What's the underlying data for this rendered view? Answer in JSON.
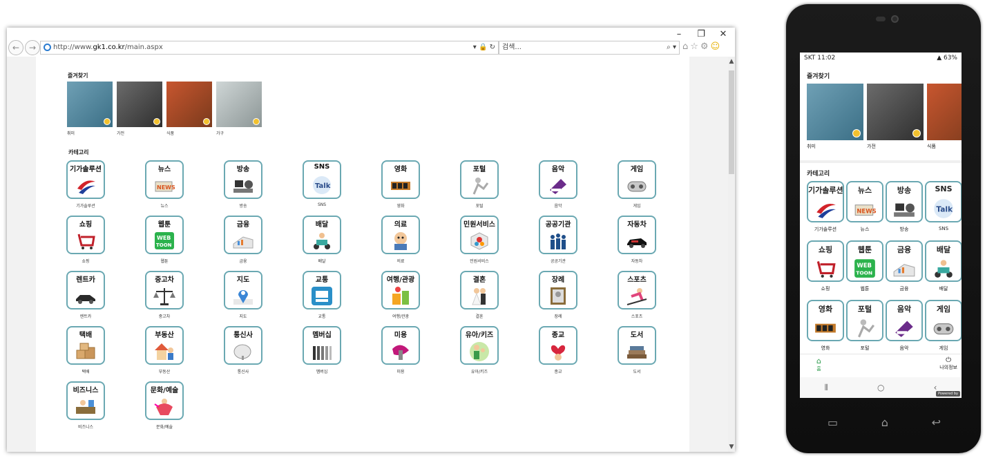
{
  "browser": {
    "url_prefix": "http://www.",
    "url_host": "gk1.co.kr",
    "url_path": "/main.aspx",
    "search_placeholder": "검색..."
  },
  "favorites": {
    "title": "즐겨찾기",
    "items": [
      {
        "label": "취미",
        "colors": [
          "#6fa0b5",
          "#3b6f86"
        ]
      },
      {
        "label": "가전",
        "colors": [
          "#6b6b6b",
          "#2f2f2f"
        ]
      },
      {
        "label": "식품",
        "colors": [
          "#c8562f",
          "#7a3a1c"
        ]
      },
      {
        "label": "가구",
        "colors": [
          "#cfd6d6",
          "#8c9696"
        ]
      }
    ]
  },
  "categories": {
    "title": "카테고리",
    "items": [
      {
        "title": "기가솔루션",
        "label": "기가솔루션",
        "icon": "giga-logo-icon"
      },
      {
        "title": "뉴스",
        "label": "뉴스",
        "icon": "news-icon"
      },
      {
        "title": "방송",
        "label": "방송",
        "icon": "broadcast-icon"
      },
      {
        "title": "SNS",
        "label": "SNS",
        "icon": "talk-icon"
      },
      {
        "title": "영화",
        "label": "영화",
        "icon": "film-icon"
      },
      {
        "title": "포털",
        "label": "포털",
        "icon": "portal-icon"
      },
      {
        "title": "음악",
        "label": "음악",
        "icon": "piano-icon"
      },
      {
        "title": "게임",
        "label": "게임",
        "icon": "gamepad-icon"
      },
      {
        "title": "쇼핑",
        "label": "쇼핑",
        "icon": "cart-icon"
      },
      {
        "title": "웹툰",
        "label": "웹툰",
        "icon": "webtoon-icon"
      },
      {
        "title": "금융",
        "label": "금융",
        "icon": "chart-icon"
      },
      {
        "title": "배달",
        "label": "배달",
        "icon": "scooter-icon"
      },
      {
        "title": "의료",
        "label": "의료",
        "icon": "doctor-icon"
      },
      {
        "title": "민원서비스",
        "label": "민원서비스",
        "icon": "cube-icon"
      },
      {
        "title": "공공기관",
        "label": "공공기관",
        "icon": "people-icon"
      },
      {
        "title": "자동차",
        "label": "자동차",
        "icon": "car-icon"
      },
      {
        "title": "렌트카",
        "label": "렌트카",
        "icon": "sedan-icon"
      },
      {
        "title": "중고차",
        "label": "중고차",
        "icon": "scale-icon"
      },
      {
        "title": "지도",
        "label": "지도",
        "icon": "map-pin-icon"
      },
      {
        "title": "교통",
        "label": "교통",
        "icon": "bus-icon"
      },
      {
        "title": "여행/관광",
        "label": "여행/관광",
        "icon": "luggage-icon"
      },
      {
        "title": "결혼",
        "label": "결혼",
        "icon": "wedding-icon"
      },
      {
        "title": "장례",
        "label": "장례",
        "icon": "frame-icon"
      },
      {
        "title": "스포츠",
        "label": "스포츠",
        "icon": "ski-icon"
      },
      {
        "title": "택배",
        "label": "택배",
        "icon": "boxes-icon"
      },
      {
        "title": "부동산",
        "label": "부동산",
        "icon": "realtor-icon"
      },
      {
        "title": "통신사",
        "label": "통신사",
        "icon": "dish-icon"
      },
      {
        "title": "멤버십",
        "label": "멤버십",
        "icon": "queue-icon"
      },
      {
        "title": "미용",
        "label": "미용",
        "icon": "lipstick-icon"
      },
      {
        "title": "유아/키즈",
        "label": "유아/키즈",
        "icon": "family-icon"
      },
      {
        "title": "종교",
        "label": "종교",
        "icon": "heart-icon"
      },
      {
        "title": "도서",
        "label": "도서",
        "icon": "books-icon"
      },
      {
        "title": "비즈니스",
        "label": "비즈니스",
        "icon": "business-icon"
      },
      {
        "title": "문화/예술",
        "label": "문화/예술",
        "icon": "dancer-icon"
      }
    ]
  },
  "phone": {
    "status_time": "SKT 11:02",
    "status_right": "63%",
    "favorites_title": "즐겨찾기",
    "favorites": [
      {
        "label": "취미",
        "colors": [
          "#6fa0b5",
          "#3b6f86"
        ]
      },
      {
        "label": "가전",
        "colors": [
          "#6b6b6b",
          "#2f2f2f"
        ]
      },
      {
        "label": "식품",
        "colors": [
          "#c8562f",
          "#7a3a1c"
        ]
      }
    ],
    "categories_title": "카테고리",
    "categories": [
      {
        "title": "기가솔루션",
        "label": "기가솔루션",
        "icon": "giga-logo-icon"
      },
      {
        "title": "뉴스",
        "label": "뉴스",
        "icon": "news-icon"
      },
      {
        "title": "방송",
        "label": "방송",
        "icon": "broadcast-icon"
      },
      {
        "title": "SNS",
        "label": "SNS",
        "icon": "talk-icon"
      },
      {
        "title": "쇼핑",
        "label": "쇼핑",
        "icon": "cart-icon"
      },
      {
        "title": "웹툰",
        "label": "웹툰",
        "icon": "webtoon-icon"
      },
      {
        "title": "금융",
        "label": "금융",
        "icon": "chart-icon"
      },
      {
        "title": "배달",
        "label": "배달",
        "icon": "scooter-icon"
      },
      {
        "title": "영화",
        "label": "영화",
        "icon": "film-icon"
      },
      {
        "title": "포털",
        "label": "포털",
        "icon": "portal-icon"
      },
      {
        "title": "음악",
        "label": "음악",
        "icon": "piano-icon"
      },
      {
        "title": "게임",
        "label": "게임",
        "icon": "gamepad-icon"
      }
    ],
    "nav_home": "홈",
    "nav_me": "나의정보",
    "powered": "Powered by"
  },
  "colors": {
    "border": "#6aa8b2",
    "accent": "#2a9a4a"
  }
}
